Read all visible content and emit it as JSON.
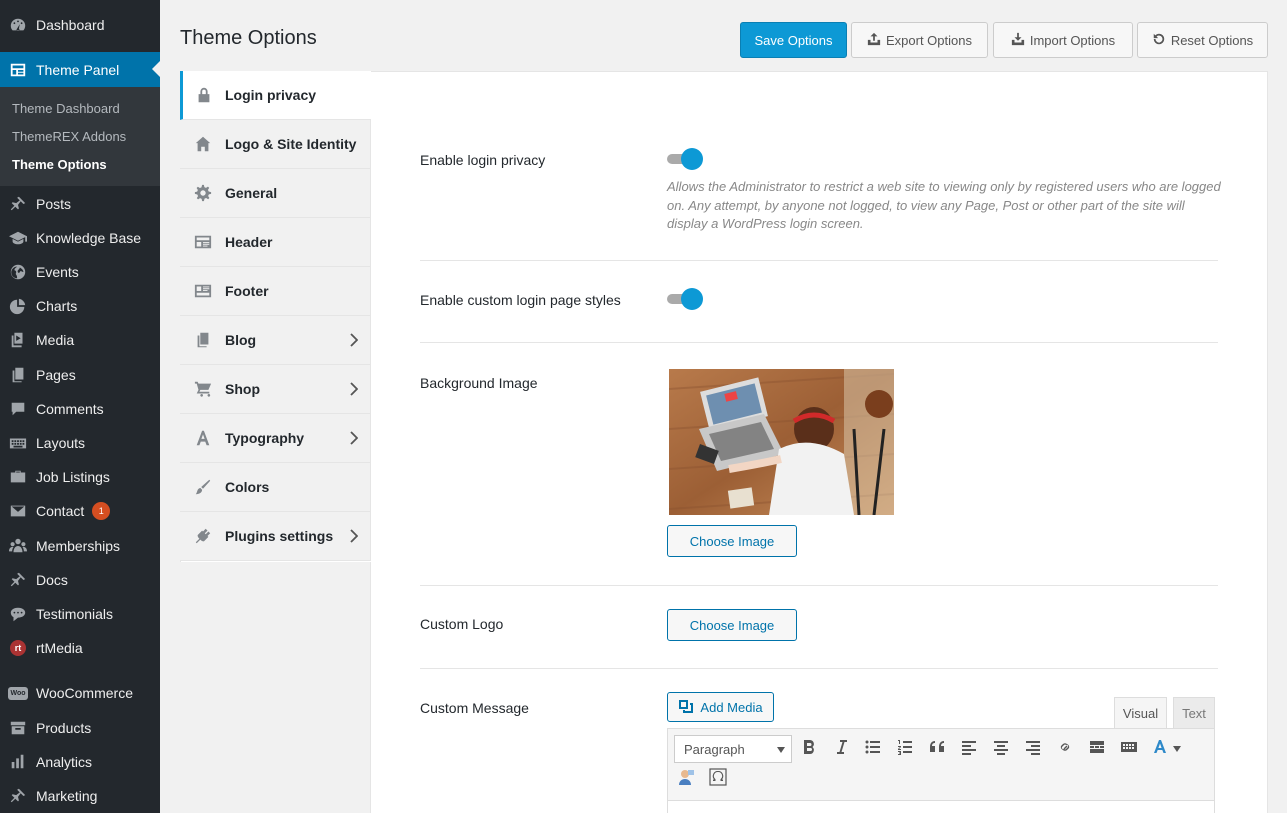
{
  "sidebar": {
    "items": [
      {
        "label": "Dashboard",
        "icon": "dashboard-icon"
      },
      {
        "label": "Theme Panel",
        "icon": "theme-panel-icon"
      },
      {
        "label": "Posts",
        "icon": "pin-icon"
      },
      {
        "label": "Knowledge Base",
        "icon": "graduation-cap-icon"
      },
      {
        "label": "Events",
        "icon": "globe-icon"
      },
      {
        "label": "Charts",
        "icon": "pie-chart-icon"
      },
      {
        "label": "Media",
        "icon": "media-icon"
      },
      {
        "label": "Pages",
        "icon": "pages-icon"
      },
      {
        "label": "Comments",
        "icon": "comment-icon"
      },
      {
        "label": "Layouts",
        "icon": "keyboard-icon"
      },
      {
        "label": "Job Listings",
        "icon": "briefcase-icon"
      },
      {
        "label": "Contact",
        "icon": "mail-icon",
        "badge": "1"
      },
      {
        "label": "Memberships",
        "icon": "groups-icon"
      },
      {
        "label": "Docs",
        "icon": "pin-icon"
      },
      {
        "label": "Testimonials",
        "icon": "testimonial-icon"
      },
      {
        "label": "rtMedia",
        "icon": "rtmedia-logo"
      },
      {
        "label": "WooCommerce",
        "icon": "woocommerce-logo"
      },
      {
        "label": "Products",
        "icon": "archive-icon"
      },
      {
        "label": "Analytics",
        "icon": "bar-chart-icon"
      },
      {
        "label": "Marketing",
        "icon": "megaphone-icon"
      }
    ],
    "submenu": [
      "Theme Dashboard",
      "ThemeREX Addons",
      "Theme Options"
    ],
    "rt_logo_text": "rt",
    "woo_logo_text": "Woo"
  },
  "header": {
    "title": "Theme Options",
    "save": "Save Options",
    "export": "Export Options",
    "import": "Import Options",
    "reset": "Reset Options"
  },
  "tabs": [
    {
      "label": "Login privacy",
      "icon": "lock-icon",
      "active": true
    },
    {
      "label": "Logo & Site Identity",
      "icon": "home-icon"
    },
    {
      "label": "General",
      "icon": "gear-icon"
    },
    {
      "label": "Header",
      "icon": "header-icon"
    },
    {
      "label": "Footer",
      "icon": "footer-icon"
    },
    {
      "label": "Blog",
      "icon": "blog-icon",
      "expandable": true
    },
    {
      "label": "Shop",
      "icon": "cart-icon",
      "expandable": true
    },
    {
      "label": "Typography",
      "icon": "typography-icon",
      "expandable": true
    },
    {
      "label": "Colors",
      "icon": "brush-icon"
    },
    {
      "label": "Plugins settings",
      "icon": "plugin-icon",
      "expandable": true
    }
  ],
  "options": {
    "login_privacy": {
      "label": "Enable login privacy",
      "enabled": true,
      "description": "Allows the Administrator to restrict a web site to viewing only by registered users who are logged on. Any attempt, by anyone not logged, to view any Page, Post or other part of the site will display a WordPress login screen."
    },
    "custom_login_styles": {
      "label": "Enable custom login page styles",
      "enabled": true
    },
    "background_image": {
      "label": "Background Image",
      "button": "Choose Image"
    },
    "custom_logo": {
      "label": "Custom Logo",
      "button": "Choose Image"
    },
    "custom_message": {
      "label": "Custom Message",
      "add_media": "Add Media",
      "tab_visual": "Visual",
      "tab_text": "Text",
      "format_value": "Paragraph"
    }
  },
  "colors": {
    "accent": "#0d99d5",
    "admin_bar": "#23282d",
    "wp_blue": "#0073aa"
  }
}
